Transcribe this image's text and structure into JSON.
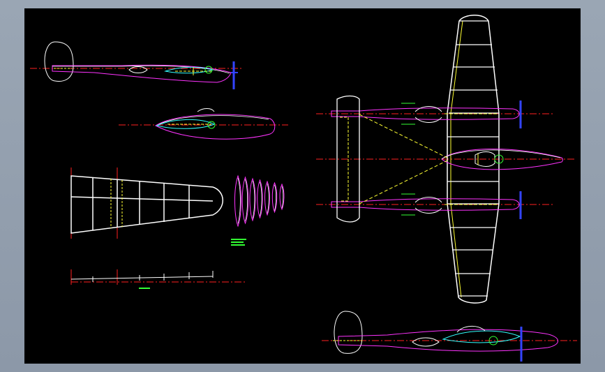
{
  "drawing": {
    "background": "#000000",
    "frame_color": "#8c98a8",
    "layer_colors": {
      "outline": "#ffffff",
      "skin": "#ff33ff",
      "centerline": "#ff2020",
      "hidden": "#ffff33",
      "canopy": "#33ffff",
      "engine": "#33ff33",
      "prop": "#3344ff"
    },
    "views": [
      "side-view",
      "side-view-fuselage",
      "wing-panel",
      "rib-profiles",
      "rib-layout",
      "top-view",
      "side-view-bottom"
    ],
    "rib_count": 7
  }
}
